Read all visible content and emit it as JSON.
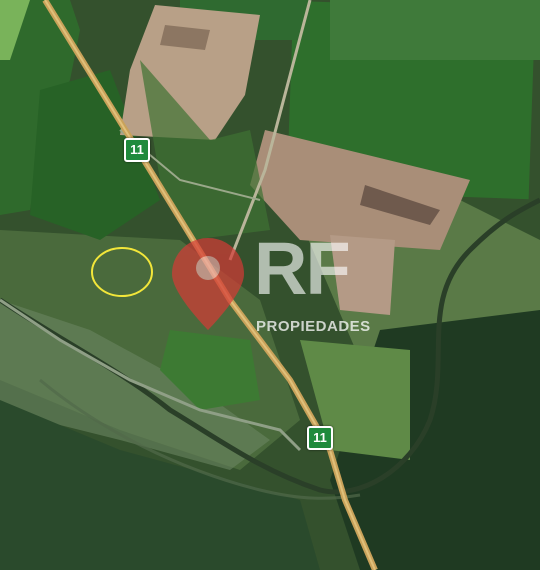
{
  "map": {
    "route_shields": [
      {
        "label": "11"
      },
      {
        "label": "11"
      }
    ],
    "watermark": {
      "letters": "RF",
      "text": "PROPIEDADES"
    },
    "colors": {
      "forest": "#2c4a28",
      "crop_green": "#2d6b2d",
      "bare_field": "#b49a80",
      "road": "#c9a25a",
      "marker_outline": "#f2e63a",
      "watermark_red": "#d63a36",
      "shield_green": "#1f8a3c"
    }
  }
}
